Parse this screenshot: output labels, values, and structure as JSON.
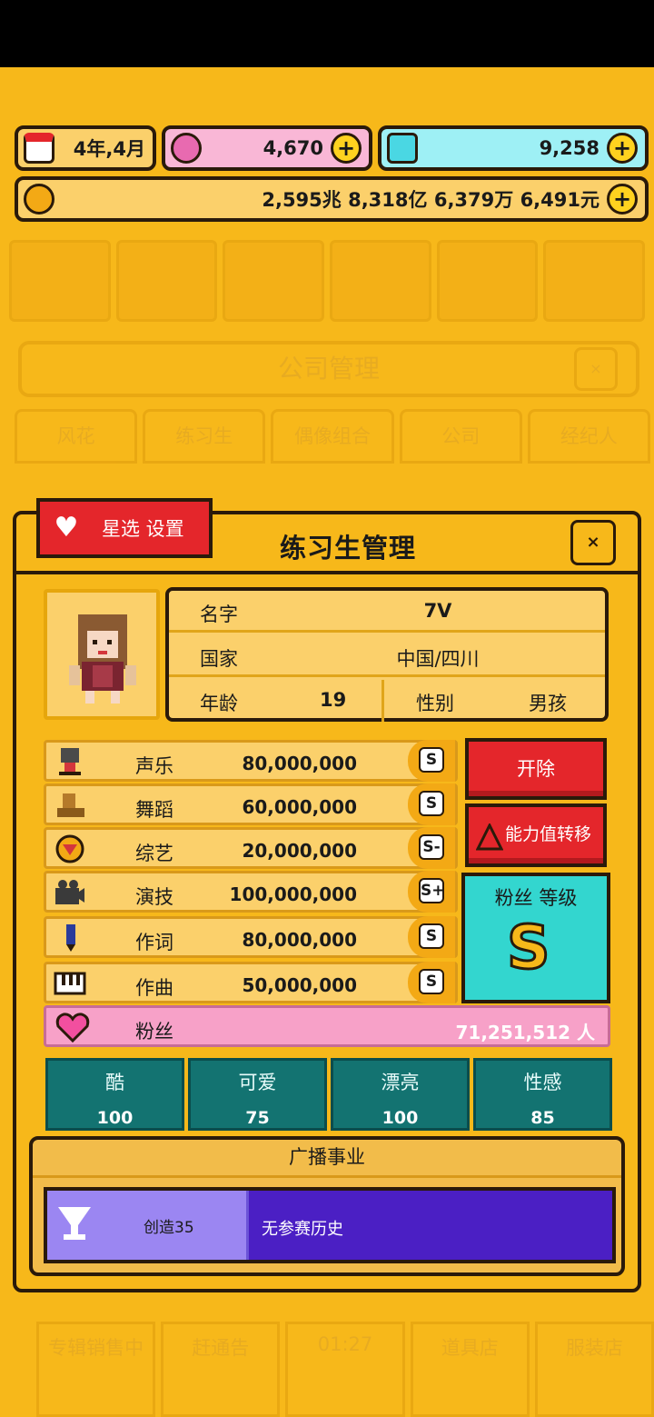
{
  "topbar": {
    "date": "4年,4月",
    "pink_currency": "4,670",
    "diamond_currency": "9,258",
    "money": "2,595兆 8,318亿 6,379万 6,491元",
    "plus": "+"
  },
  "background": {
    "title": "公司管理",
    "close": "×",
    "tabs": [
      "风花",
      "练习生",
      "偶像组合",
      "公司",
      "经纪人"
    ]
  },
  "modal": {
    "title": "练习生管理",
    "close": "×",
    "star_button": "星选 设置",
    "profile": {
      "name_label": "名字",
      "name": "7V",
      "country_label": "国家",
      "country": "中国/四川",
      "age_label": "年龄",
      "age": "19",
      "gender_label": "性别",
      "gender": "男孩"
    },
    "stats": [
      {
        "name": "声乐",
        "value": "80,000,000",
        "grade": "S"
      },
      {
        "name": "舞蹈",
        "value": "60,000,000",
        "grade": "S"
      },
      {
        "name": "综艺",
        "value": "20,000,000",
        "grade": "S-"
      },
      {
        "name": "演技",
        "value": "100,000,000",
        "grade": "S+"
      },
      {
        "name": "作词",
        "value": "80,000,000",
        "grade": "S"
      },
      {
        "name": "作曲",
        "value": "50,000,000",
        "grade": "S"
      }
    ],
    "fans": {
      "label": "粉丝",
      "value": "71,251,512 人"
    },
    "fire_button": "开除",
    "transfer_button": "能力值转移",
    "fan_level": {
      "title": "粉丝 等级",
      "grade": "S"
    },
    "attributes": [
      {
        "name": "酷",
        "value": "100"
      },
      {
        "name": "可爱",
        "value": "75"
      },
      {
        "name": "漂亮",
        "value": "100"
      },
      {
        "name": "性感",
        "value": "85"
      }
    ],
    "broadcast": {
      "title": "广播事业",
      "show": "创造35",
      "history": "无参赛历史"
    }
  },
  "bottom_nav": [
    "专辑销售中",
    "赶通告",
    "01:27",
    "道具店",
    "服装店"
  ],
  "colors": {
    "background": "#f7b81a",
    "red_button": "#e4262b",
    "fan_level": "#33d6cf",
    "attributes": "#137371",
    "fans_row": "#f7a1c8",
    "broadcast": "#4b1fc4"
  }
}
